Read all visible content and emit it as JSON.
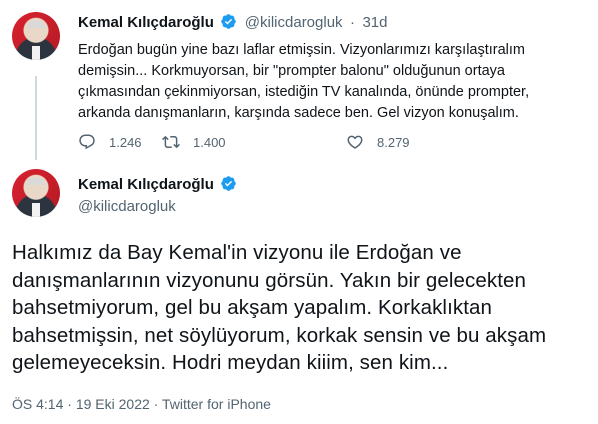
{
  "tweet1": {
    "name": "Kemal Kılıçdaroğlu",
    "handle": "@kilicdarogluk",
    "separator": "·",
    "time": "31d",
    "text": "Erdoğan bugün yine bazı laflar etmişsin. Vizyonlarımızı karşılaştıralım demişsin... Korkmuyorsan, bir \"prompter balonu\" olduğunun ortaya çıkmasından çekinmiyorsan, istediğin TV kanalında, önünde prompter, arkanda danışmanların, karşında sadece ben. Gel vizyon konuşalım.",
    "replies": "1.246",
    "retweets": "1.400",
    "likes": "8.279"
  },
  "tweet2": {
    "name": "Kemal Kılıçdaroğlu",
    "handle": "@kilicdarogluk",
    "text": "Halkımız da Bay Kemal'in vizyonu ile Erdoğan ve danışmanlarının vizyonunu görsün. Yakın bir gelecekten bahsetmiyorum, gel bu akşam yapalım. Korkaklıktan bahsetmişsin, net söylüyorum, korkak sensin ve bu akşam gelemeyeceksin. Hodri meydan kiiim, sen kim...",
    "time": "ÖS 4:14",
    "date": "19 Eki 2022",
    "source": "Twitter for iPhone",
    "separator": "·"
  },
  "colors": {
    "verified": "#1d9bf0",
    "text": "#0f1419",
    "secondary": "#536471",
    "thread_line": "#cfd9de"
  },
  "icons": [
    "reply-icon",
    "retweet-icon",
    "like-icon",
    "verified-badge-icon"
  ]
}
